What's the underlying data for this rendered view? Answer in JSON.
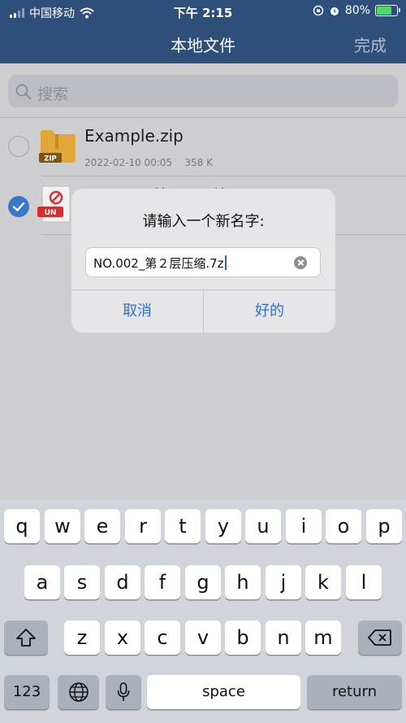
{
  "status_bar": {
    "carrier": "中国移动",
    "time": "下午 2:15",
    "battery": "80%",
    "battery_level": 0.8
  },
  "nav": {
    "title": "本地文件",
    "done": "完成"
  },
  "search": {
    "placeholder": "搜索"
  },
  "files": [
    {
      "name": "Example.zip",
      "date": "2022-02-10 00:05",
      "size": "358 K",
      "badge": "ZIP",
      "selected": false
    },
    {
      "name": "NO.002_第2层压缩.01",
      "badge": "UN",
      "selected": true
    }
  ],
  "dialog": {
    "title": "请输入一个新名字:",
    "input_value": "NO.002_第２层压缩.7z",
    "cancel": "取消",
    "ok": "好的"
  },
  "keyboard": {
    "row1": [
      "q",
      "w",
      "e",
      "r",
      "t",
      "y",
      "u",
      "i",
      "o",
      "p"
    ],
    "row2": [
      "a",
      "s",
      "d",
      "f",
      "g",
      "h",
      "j",
      "k",
      "l"
    ],
    "row3": [
      "z",
      "x",
      "c",
      "v",
      "b",
      "n",
      "m"
    ],
    "numbers": "123",
    "space": "space",
    "return": "return"
  },
  "colors": {
    "accent": "#2f6fd1",
    "nav": "#2f4f7b",
    "zip_folder": "#e0a83a",
    "un_badge": "#d0312d"
  }
}
